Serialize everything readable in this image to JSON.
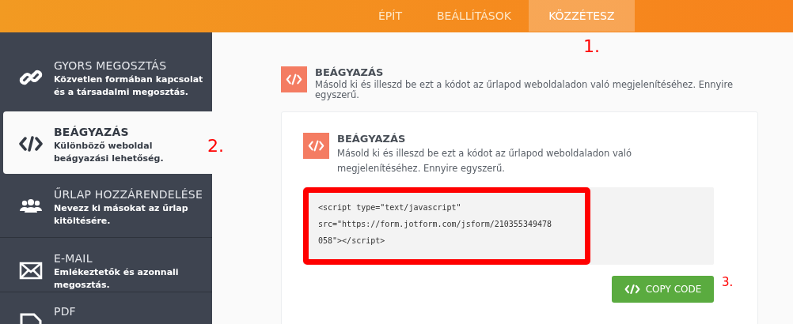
{
  "top_tabs": [
    {
      "label": "ÉPÍT",
      "selected": false
    },
    {
      "label": "BEÁLLÍTÁSOK",
      "selected": false
    },
    {
      "label": "KÖZZÉTESZ",
      "selected": true
    }
  ],
  "sidebar": {
    "items": [
      {
        "kind": "link",
        "title": "GYORS MEGOSZTÁS",
        "description": "Közvetlen formában kapcsolat és a társadalmi megosztás.",
        "selected": false
      },
      {
        "kind": "code",
        "title": "BEÁGYAZÁS",
        "description": "Különböző weboldal beágyazási lehetőség.",
        "selected": true
      },
      {
        "kind": "users",
        "title": "ŰRLAP HOZZÁRENDELÉSE",
        "description": "Nevezz ki másokat az űrlap kitöltésére.",
        "selected": false
      },
      {
        "kind": "mail",
        "title": "E-MAIL",
        "description": "Emlékeztetők és azonnali megosztás.",
        "selected": false
      },
      {
        "kind": "pdf",
        "title": "PDF",
        "selected": false
      }
    ]
  },
  "section": {
    "title": "BEÁGYAZÁS",
    "description": "Másold ki és illeszd be ezt a kódot az űrlapod weboldaladon való megjelenítéséhez. Ennyire egyszerű."
  },
  "card": {
    "title": "BEÁGYAZÁS",
    "description": "Másold ki és illeszd be ezt a kódot az űrlapod weboldaladon való megjelenítéséhez. Ennyire egyszerű.",
    "code_lines": [
      "<script type=\"text/javascript\"",
      "src=\"https://form.jotform.com/jsform/210355349478",
      "058\"></script>"
    ],
    "copy_button": "COPY CODE"
  },
  "annotations": [
    "1.",
    "2.",
    "3."
  ]
}
